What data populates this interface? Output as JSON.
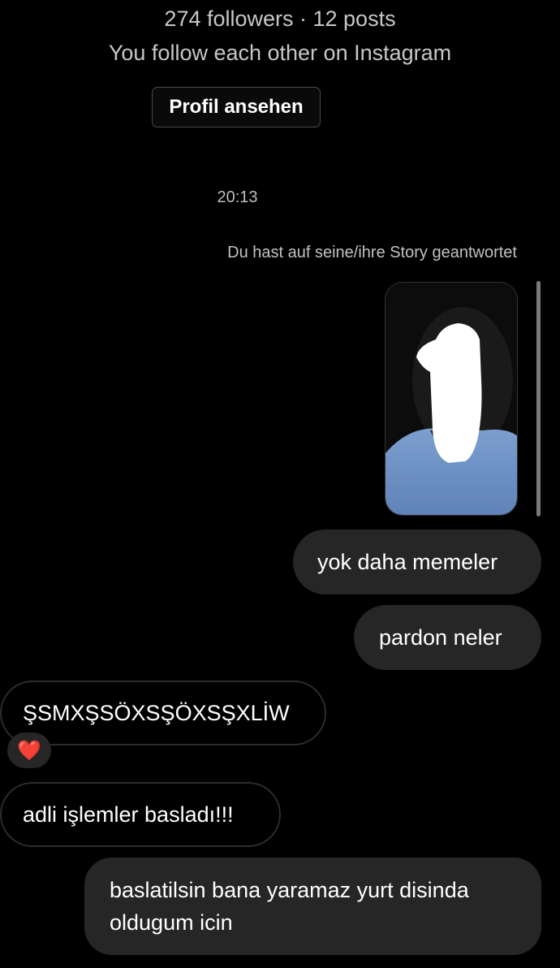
{
  "header": {
    "stats": "274 followers · 12 posts",
    "mutual": "You follow each other on Instagram",
    "profile_button": "Profil ansehen"
  },
  "conversation": {
    "timestamp": "20:13",
    "story_reply_note": "Du hast auf seine/ihre Story geantwortet",
    "messages": [
      {
        "direction": "outgoing",
        "text": "yok daha memeler"
      },
      {
        "direction": "outgoing",
        "text": "pardon neler"
      },
      {
        "direction": "incoming",
        "text": "ŞSMXŞSÖXSŞÖXSŞXLİW",
        "reaction": "❤️"
      },
      {
        "direction": "incoming",
        "text": "adli işlemler basladı!!!"
      },
      {
        "direction": "outgoing",
        "text": "baslatilsin bana yaramaz yurt disinda\noldugum icin"
      }
    ]
  },
  "colors": {
    "background": "#000000",
    "bubble": "#262626",
    "muted_text": "#c7c7c7",
    "reaction_heart": "#e0243c"
  }
}
